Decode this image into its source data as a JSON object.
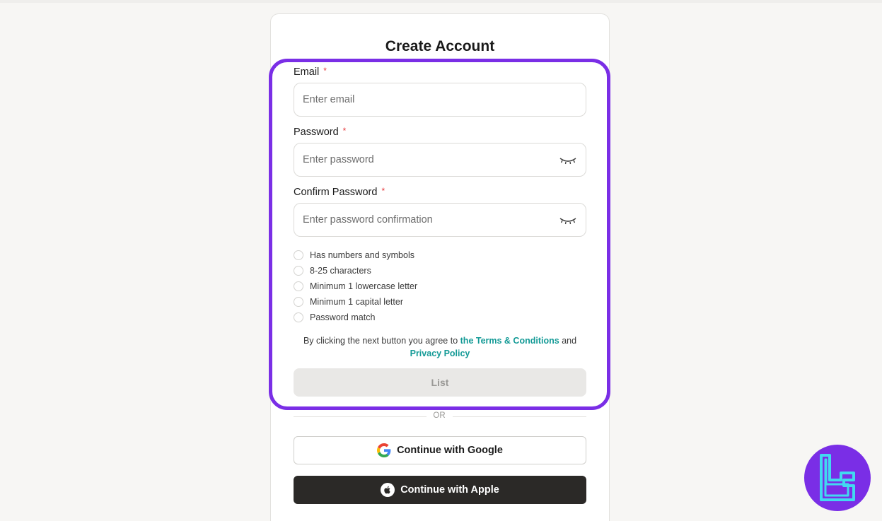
{
  "form": {
    "title": "Create Account",
    "email": {
      "label": "Email",
      "required_mark": "*",
      "placeholder": "Enter email",
      "value": ""
    },
    "password": {
      "label": "Password",
      "required_mark": "*",
      "placeholder": "Enter password",
      "value": ""
    },
    "confirm": {
      "label": "Confirm Password",
      "required_mark": "*",
      "placeholder": "Enter password confirmation",
      "value": ""
    },
    "requirements": [
      {
        "text": "Has numbers and symbols",
        "met": false
      },
      {
        "text": "8-25 characters",
        "met": false
      },
      {
        "text": "Minimum 1 lowercase letter",
        "met": false
      },
      {
        "text": "Minimum 1 capital letter",
        "met": false
      },
      {
        "text": "Password match",
        "met": false
      }
    ],
    "terms": {
      "prefix": "By clicking the next button you agree to",
      "terms_link": "the Terms & Conditions",
      "conjunction": "and",
      "privacy_link": "Privacy Policy"
    },
    "submit_label": "List"
  },
  "divider": {
    "text": "OR"
  },
  "social": {
    "google_label": "Continue with Google",
    "apple_label": "Continue with Apple"
  },
  "colors": {
    "highlight": "#7a2ee6",
    "link": "#139a96",
    "required": "#e5383b",
    "apple_button": "#2b2927",
    "brand_badge": "#7a2ee6",
    "brand_glyph": "#41d9f0"
  },
  "icons": {
    "password_toggle": "eye-closed-icon",
    "google": "google-icon",
    "apple": "apple-icon",
    "brand": "brand-logo"
  }
}
